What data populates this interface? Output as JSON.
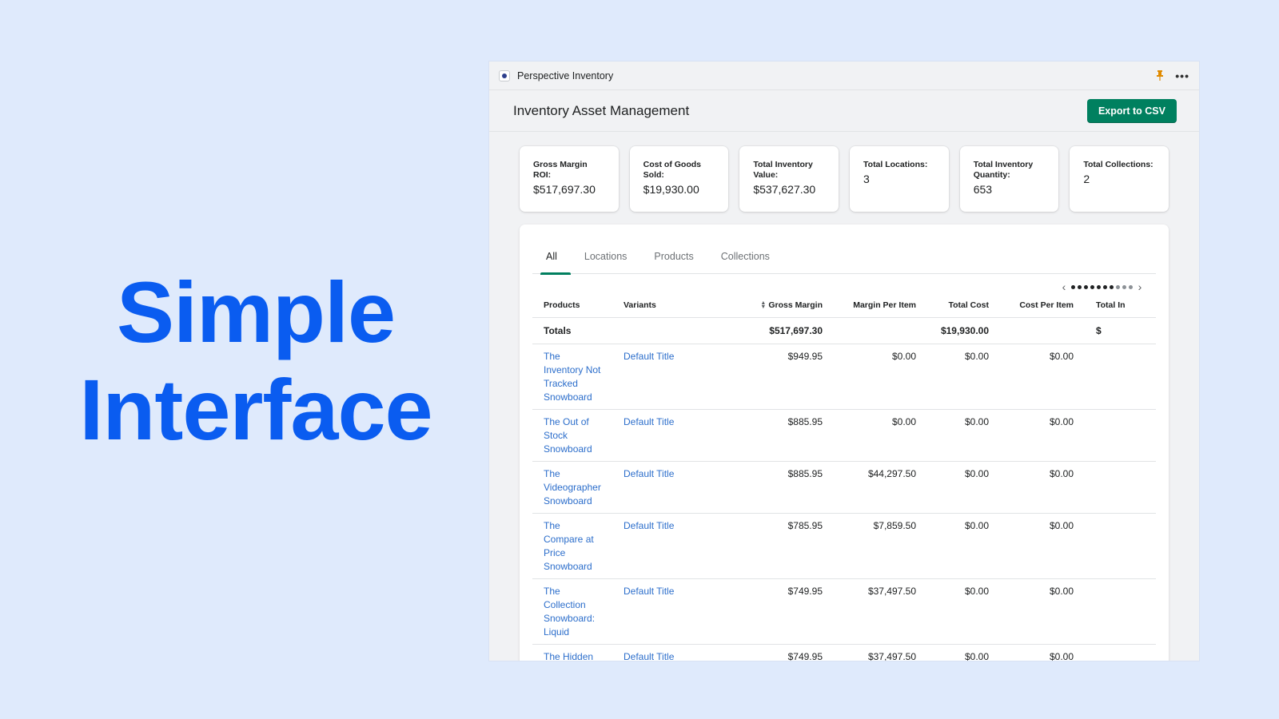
{
  "hero": {
    "line1": "Simple",
    "line2": "Interface"
  },
  "titlebar": {
    "app_name": "Perspective Inventory",
    "pin_icon": "pin-icon",
    "more_icon": "more-icon"
  },
  "header": {
    "title": "Inventory Asset Management",
    "export_label": "Export to CSV",
    "accent": "#00805f"
  },
  "stats": [
    {
      "label": "Gross Margin ROI:",
      "value": "$517,697.30"
    },
    {
      "label": "Cost of Goods Sold:",
      "value": "$19,930.00"
    },
    {
      "label": "Total Inventory Value:",
      "value": "$537,627.30"
    },
    {
      "label": "Total Locations:",
      "value": "3"
    },
    {
      "label": "Total Inventory Quantity:",
      "value": "653"
    },
    {
      "label": "Total Collections:",
      "value": "2"
    }
  ],
  "tabs": [
    "All",
    "Locations",
    "Products",
    "Collections"
  ],
  "active_tab": "All",
  "pager": {
    "total_dots": 10,
    "active_dots": 7
  },
  "table": {
    "columns": [
      "Products",
      "Variants",
      "Gross Margin",
      "Margin Per Item",
      "Total Cost",
      "Cost Per Item",
      "Total In"
    ],
    "totals": {
      "label": "Totals",
      "gross_margin": "$517,697.30",
      "total_cost": "$19,930.00",
      "total_in": "$"
    },
    "rows": [
      {
        "product": "The Inventory Not Tracked Snowboard",
        "variant": "Default Title",
        "gross_margin": "$949.95",
        "margin_per_item": "$0.00",
        "total_cost": "$0.00",
        "cost_per_item": "$0.00"
      },
      {
        "product": "The Out of Stock Snowboard",
        "variant": "Default Title",
        "gross_margin": "$885.95",
        "margin_per_item": "$0.00",
        "total_cost": "$0.00",
        "cost_per_item": "$0.00"
      },
      {
        "product": "The Videographer Snowboard",
        "variant": "Default Title",
        "gross_margin": "$885.95",
        "margin_per_item": "$44,297.50",
        "total_cost": "$0.00",
        "cost_per_item": "$0.00"
      },
      {
        "product": "The Compare at Price Snowboard",
        "variant": "Default Title",
        "gross_margin": "$785.95",
        "margin_per_item": "$7,859.50",
        "total_cost": "$0.00",
        "cost_per_item": "$0.00"
      },
      {
        "product": "The Collection Snowboard: Liquid",
        "variant": "Default Title",
        "gross_margin": "$749.95",
        "margin_per_item": "$37,497.50",
        "total_cost": "$0.00",
        "cost_per_item": "$0.00"
      },
      {
        "product": "The Hidden Snowboard",
        "variant": "Default Title",
        "gross_margin": "$749.95",
        "margin_per_item": "$37,497.50",
        "total_cost": "$0.00",
        "cost_per_item": "$0.00"
      }
    ]
  }
}
